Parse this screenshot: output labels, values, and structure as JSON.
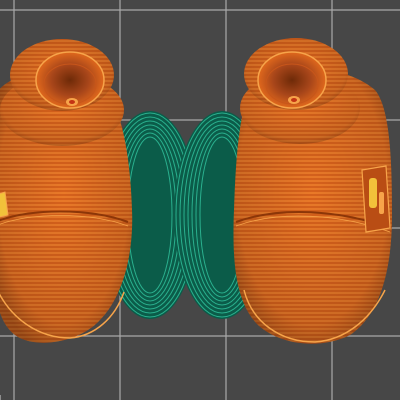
{
  "viewport": {
    "background_color": "#474747",
    "bed_grid_color": "#a9a9a9",
    "bed_edge_color": "#8e8e8e"
  },
  "objects": [
    {
      "name": "left-shoe",
      "body_color": "#e0681c",
      "highlight_color": "#f7a44a",
      "shadow_color": "#8c3608"
    },
    {
      "name": "right-shoe",
      "body_color": "#e0681c",
      "highlight_color": "#f7a44a",
      "shadow_color": "#8c3608"
    }
  ],
  "brim": {
    "color": "#14856c",
    "line_color": "#2ab08e",
    "dark_color": "#0b5c49"
  },
  "icons": {
    "bed": "print-bed-grid",
    "brim": "brim-perimeter"
  }
}
